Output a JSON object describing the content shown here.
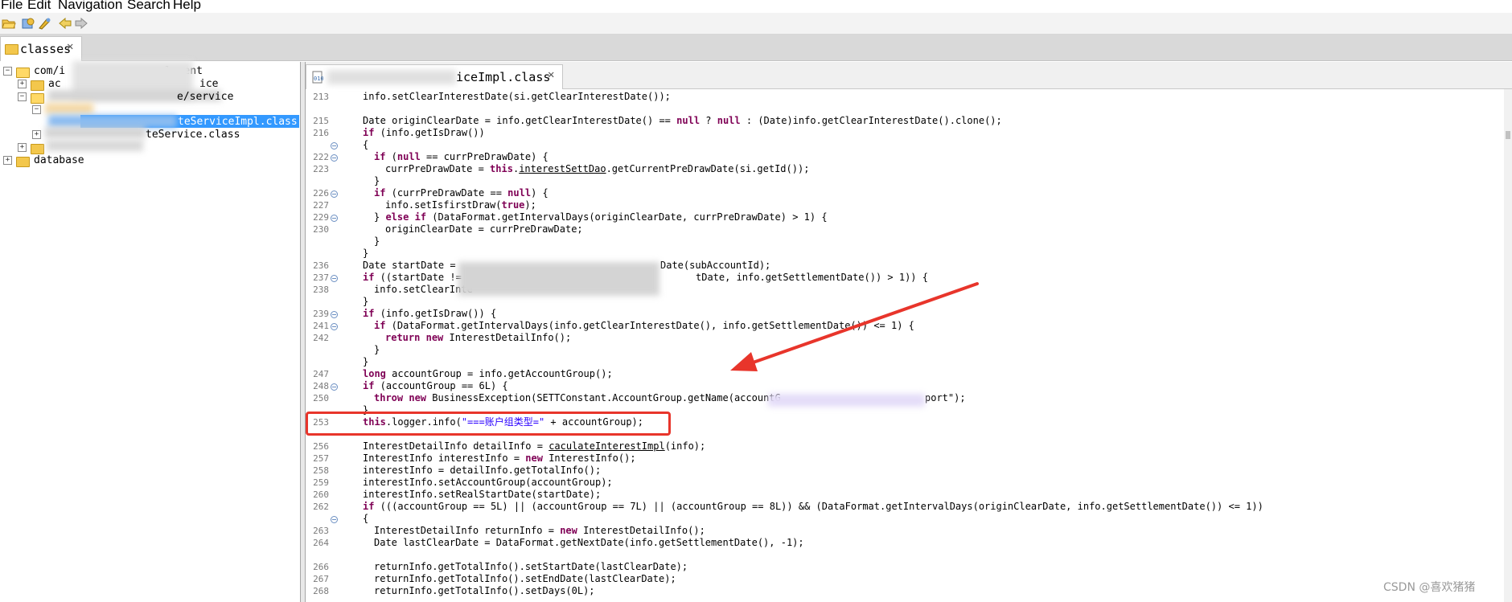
{
  "menu": [
    "File",
    "Edit",
    "Navigation",
    "Search",
    "Help"
  ],
  "tabs": {
    "classes_tab": "classes"
  },
  "tree": {
    "row1": "com/i",
    "row1_tail": "lement",
    "row2_tail": "ice",
    "row2_prefix": "ac",
    "row3_tail": "e/service",
    "row4_selected": "teServiceImpl.class",
    "row5_tail": "teService.class",
    "database": "database"
  },
  "editor_tab": {
    "label_visible": "iceImpl.class"
  },
  "code": [
    {
      "n": "213",
      "text": "info.setClearInterestDate(si.getClearInterestDate());"
    },
    {
      "n": "215",
      "text": "Date originClearDate = info.getClearInterestDate() == null ? null : (Date)info.getClearInterestDate().clone();"
    },
    {
      "n": "216",
      "text": "if (info.getIsDraw())"
    },
    {
      "n": "",
      "text": "{"
    },
    {
      "n": "222",
      "text": "if (null == currPreDrawDate) {"
    },
    {
      "n": "223",
      "text": "currPreDrawDate = this.interestSettDao.getCurrentPreDrawDate(si.getId());"
    },
    {
      "n": "",
      "text": "}"
    },
    {
      "n": "226",
      "text": "if (currPreDrawDate == null) {"
    },
    {
      "n": "227",
      "text": "info.setIsfirstDraw(true);"
    },
    {
      "n": "229",
      "text": "} else if (DataFormat.getIntervalDays(originClearDate, currPreDrawDate) > 1) {"
    },
    {
      "n": "230",
      "text": "originClearDate = currPreDrawDate;"
    },
    {
      "n": "",
      "text": "}"
    },
    {
      "n": "",
      "text": "}"
    },
    {
      "n": "236",
      "text": "Date startDate = ",
      "tail": "Date(subAccountId);"
    },
    {
      "n": "237",
      "text": "if ((startDate != ",
      "tail": "tDate, info.getSettlementDate()) > 1)) {"
    },
    {
      "n": "238",
      "text": "info.setClearInte"
    },
    {
      "n": "",
      "text": "}"
    },
    {
      "n": "239",
      "text": "if (info.getIsDraw()) {"
    },
    {
      "n": "241",
      "text": "if (DataFormat.getIntervalDays(info.getClearInterestDate(), info.getSettlementDate()) <= 1) {"
    },
    {
      "n": "242",
      "text": "return new InterestDetailInfo();"
    },
    {
      "n": "",
      "text": "}"
    },
    {
      "n": "",
      "text": "}"
    },
    {
      "n": "247",
      "text": "long accountGroup = info.getAccountGroup();"
    },
    {
      "n": "248",
      "text": "if (accountGroup == 6L) {"
    },
    {
      "n": "250",
      "text": "throw new BusinessException(SETTConstant.AccountGroup.getName(accountG",
      "tail": "port\");"
    },
    {
      "n": "",
      "text": "}"
    },
    {
      "n": "253",
      "text": "this.logger.info(\"===账户组类型=\" + accountGroup);"
    },
    {
      "n": "",
      "text": ""
    },
    {
      "n": "256",
      "text": "InterestDetailInfo detailInfo = caculateInterestImpl(info);"
    },
    {
      "n": "257",
      "text": "InterestInfo interestInfo = new InterestInfo();"
    },
    {
      "n": "258",
      "text": "interestInfo = detailInfo.getTotalInfo();"
    },
    {
      "n": "259",
      "text": "interestInfo.setAccountGroup(accountGroup);"
    },
    {
      "n": "260",
      "text": "interestInfo.setRealStartDate(startDate);"
    },
    {
      "n": "262",
      "text": "if (((accountGroup == 5L) || (accountGroup == 7L) || (accountGroup == 8L)) && (DataFormat.getIntervalDays(originClearDate, info.getSettlementDate()) <= 1))"
    },
    {
      "n": "",
      "text": "{"
    },
    {
      "n": "263",
      "text": "InterestDetailInfo returnInfo = new InterestDetailInfo();"
    },
    {
      "n": "264",
      "text": "Date lastClearDate = DataFormat.getNextDate(info.getSettlementDate(), -1);"
    },
    {
      "n": "",
      "text": ""
    },
    {
      "n": "266",
      "text": "returnInfo.getTotalInfo().setStartDate(lastClearDate);"
    },
    {
      "n": "267",
      "text": "returnInfo.getTotalInfo().setEndDate(lastClearDate);"
    },
    {
      "n": "268",
      "text": "returnInfo.getTotalInfo().setDays(0L);"
    }
  ],
  "watermark": "CSDN @喜欢猪猪",
  "colors": {
    "selection": "#3399ff",
    "annotation_red": "#e8352b",
    "keyword": "#7f0055",
    "string": "#2a00ff"
  },
  "icons": [
    "open-folder-icon",
    "open-type-icon",
    "back-icon",
    "forward-icon",
    "folder-icon",
    "class-file-icon",
    "close-icon"
  ]
}
